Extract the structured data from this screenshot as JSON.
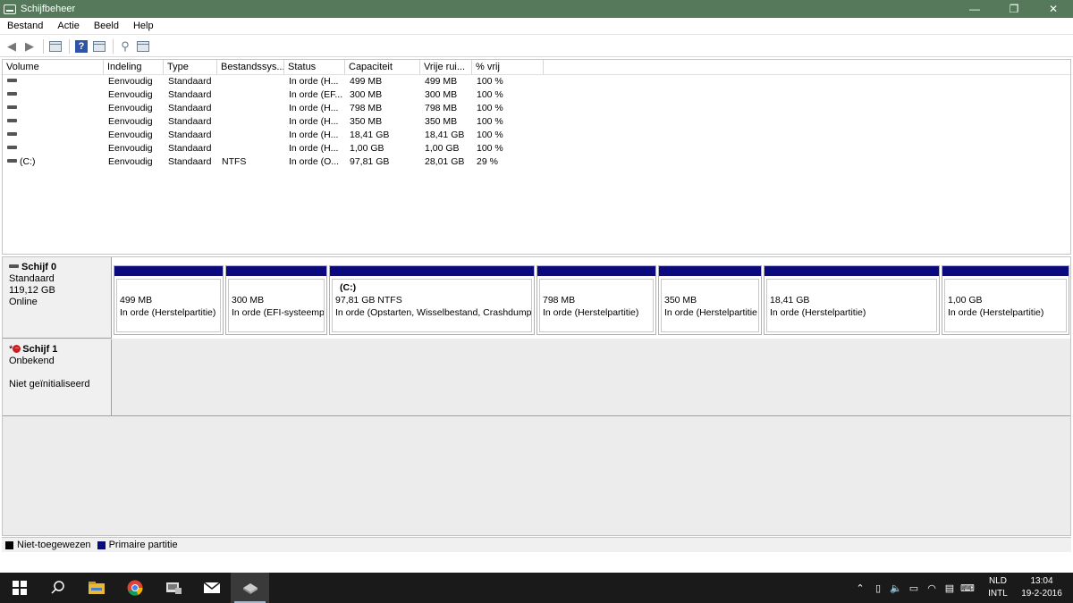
{
  "window": {
    "title": "Schijfbeheer"
  },
  "menu": [
    "Bestand",
    "Actie",
    "Beeld",
    "Help"
  ],
  "volumes": {
    "headers": [
      "Volume",
      "Indeling",
      "Type",
      "Bestandssys...",
      "Status",
      "Capaciteit",
      "Vrije rui...",
      "% vrij"
    ],
    "rows": [
      [
        "",
        "Eenvoudig",
        "Standaard",
        "",
        "In orde (H...",
        "499 MB",
        "499 MB",
        "100 %"
      ],
      [
        "",
        "Eenvoudig",
        "Standaard",
        "",
        "In orde (EF...",
        "300 MB",
        "300 MB",
        "100 %"
      ],
      [
        "",
        "Eenvoudig",
        "Standaard",
        "",
        "In orde (H...",
        "798 MB",
        "798 MB",
        "100 %"
      ],
      [
        "",
        "Eenvoudig",
        "Standaard",
        "",
        "In orde (H...",
        "350 MB",
        "350 MB",
        "100 %"
      ],
      [
        "",
        "Eenvoudig",
        "Standaard",
        "",
        "In orde (H...",
        "18,41 GB",
        "18,41 GB",
        "100 %"
      ],
      [
        "",
        "Eenvoudig",
        "Standaard",
        "",
        "In orde (H...",
        "1,00 GB",
        "1,00 GB",
        "100 %"
      ],
      [
        "(C:)",
        "Eenvoudig",
        "Standaard",
        "NTFS",
        "In orde (O...",
        "97,81 GB",
        "28,01 GB",
        "29 %"
      ]
    ]
  },
  "disk0": {
    "name": "Schijf 0",
    "type": "Standaard",
    "size": "119,12 GB",
    "state": "Online",
    "partitions": [
      {
        "name": "",
        "size": "499 MB",
        "status": "In orde (Herstelpartitie)"
      },
      {
        "name": "",
        "size": "300 MB",
        "status": "In orde (EFI-systeemp"
      },
      {
        "name": "(C:)",
        "size": "97,81 GB NTFS",
        "status": "In orde (Opstarten, Wisselbestand, Crashdump,"
      },
      {
        "name": "",
        "size": "798 MB",
        "status": "In orde (Herstelpartitie)"
      },
      {
        "name": "",
        "size": "350 MB",
        "status": "In orde (Herstelpartitie"
      },
      {
        "name": "",
        "size": "18,41 GB",
        "status": "In orde (Herstelpartitie)"
      },
      {
        "name": "",
        "size": "1,00 GB",
        "status": "In orde (Herstelpartitie)"
      }
    ]
  },
  "disk1": {
    "prefix": "*",
    "name": "Schijf 1",
    "type": "Onbekend",
    "state": "Niet geïnitialiseerd"
  },
  "legend": [
    {
      "label": "Niet-toegewezen",
      "color": "#000000"
    },
    {
      "label": "Primaire partitie",
      "color": "#0a0a7c"
    }
  ],
  "taskbar": {
    "apps": [
      "windows-start",
      "search",
      "file-explorer",
      "chrome",
      "app-5",
      "mail",
      "disk-management"
    ],
    "language": [
      "NLD",
      "INTL"
    ],
    "time": "13:04",
    "date": "19-2-2016"
  },
  "colors": {
    "titlebar": "#55795a",
    "partition_bar": "#0a0a7c"
  }
}
